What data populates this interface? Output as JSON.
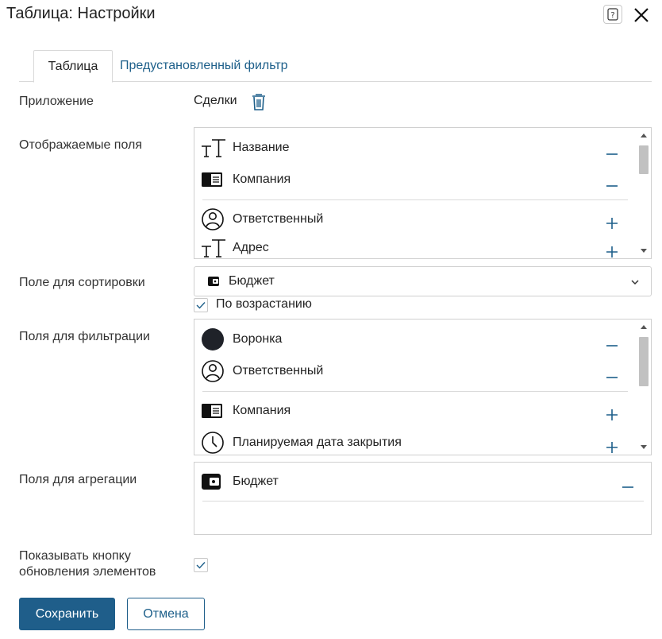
{
  "dialog": {
    "title": "Таблица: Настройки",
    "help_label": "?"
  },
  "tabs": [
    {
      "label": "Таблица",
      "active": true
    },
    {
      "label": "Предустановленный фильтр",
      "active": false
    }
  ],
  "application": {
    "label": "Приложение",
    "value": "Сделки"
  },
  "display_fields": {
    "label": "Отображаемые поля",
    "selected": [
      {
        "label": "Название",
        "icon": "text-type-icon",
        "action": "remove"
      },
      {
        "label": "Компания",
        "icon": "company-card-icon",
        "action": "remove"
      }
    ],
    "available": [
      {
        "label": "Ответственный",
        "icon": "user-icon",
        "action": "add"
      },
      {
        "label": "Адрес",
        "icon": "text-type-icon",
        "action": "add"
      }
    ]
  },
  "sort_field": {
    "label": "Поле для сортировки",
    "value": "Бюджет",
    "icon": "wallet-icon",
    "ascending_label": "По возрастанию",
    "ascending": true
  },
  "filter_fields": {
    "label": "Поля для фильтрации",
    "selected": [
      {
        "label": "Воронка",
        "icon": "funnel-dot-icon",
        "action": "remove"
      },
      {
        "label": "Ответственный",
        "icon": "user-icon",
        "action": "remove"
      }
    ],
    "available": [
      {
        "label": "Компания",
        "icon": "company-card-icon",
        "action": "add"
      },
      {
        "label": "Планируемая дата закрытия",
        "icon": "clock-icon",
        "action": "add"
      }
    ]
  },
  "aggregation_fields": {
    "label": "Поля для агрегации",
    "selected": [
      {
        "label": "Бюджет",
        "icon": "wallet-icon",
        "action": "remove"
      }
    ]
  },
  "refresh_button_option": {
    "label_line1": "Показывать кнопку",
    "label_line2": "обновления элементов",
    "checked": true
  },
  "buttons": {
    "save": "Сохранить",
    "cancel": "Отмена"
  },
  "colors": {
    "accent": "#1f5e8a",
    "link": "#1d5f8a",
    "border": "#cfcfcf"
  }
}
